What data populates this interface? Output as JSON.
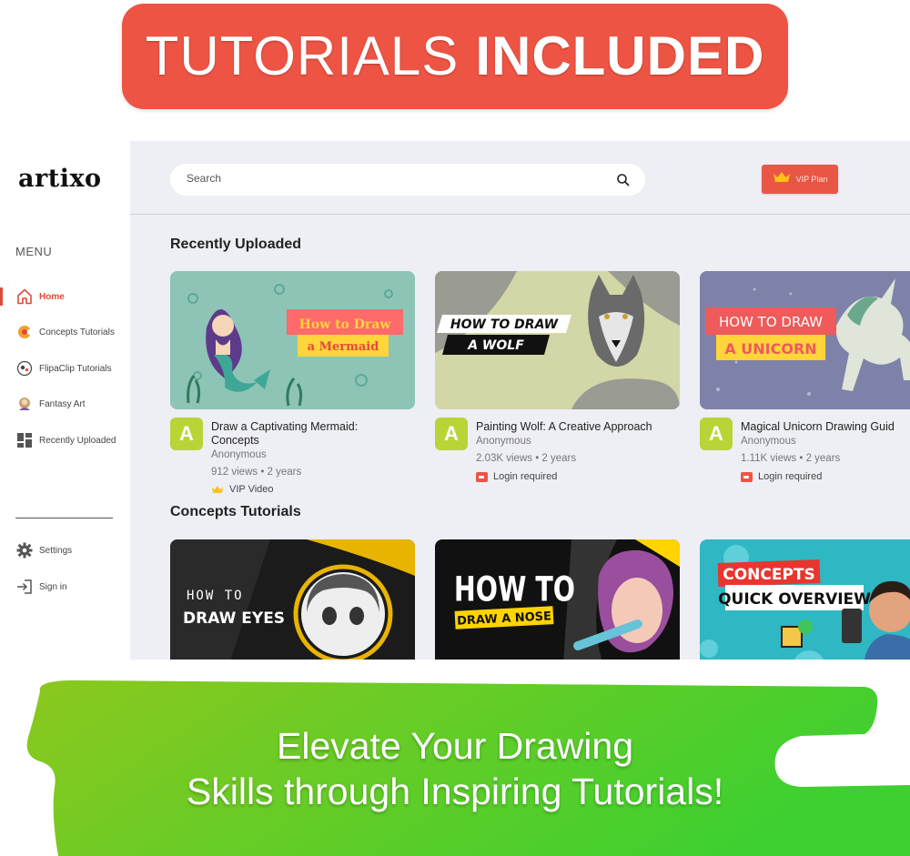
{
  "banner": {
    "top_word1": "TUTORIALS",
    "top_word2": "INCLUDED",
    "bottom_line1": "Elevate Your Drawing",
    "bottom_line2": "Skills through Inspiring Tutorials!",
    "top_color": "#ee5444",
    "bottom_gradient": [
      "#8cc81e",
      "#3ed030"
    ]
  },
  "app": {
    "logo": "artixo",
    "menu_label": "MENU",
    "nav": [
      {
        "label": "Home",
        "icon": "home-icon",
        "active": true
      },
      {
        "label": "Concepts Tutorials",
        "icon": "concepts-icon",
        "active": false
      },
      {
        "label": "FlipaClip Tutorials",
        "icon": "flipaclip-icon",
        "active": false
      },
      {
        "label": "Fantasy Art",
        "icon": "fantasy-art-icon",
        "active": false
      },
      {
        "label": "Recently Uploaded",
        "icon": "grid-icon",
        "active": false
      }
    ],
    "bottom_nav": [
      {
        "label": "Settings",
        "icon": "gear-icon"
      },
      {
        "label": "Sign in",
        "icon": "sign-in-icon"
      }
    ],
    "search": {
      "placeholder": "Search"
    },
    "vip_label": "VIP Plan",
    "accent": "#ea5644",
    "avatar_color": "#b7d537"
  },
  "sections": [
    {
      "title": "Recently Uploaded",
      "cards": [
        {
          "avatar": "A",
          "title_line1": "Draw a Captivating Mermaid:",
          "title_line2": "Concepts",
          "author": "Anonymous",
          "stats": "912 views • 2 years",
          "tag": "VIP Video",
          "tag_icon": "crown-icon",
          "thumb_text1": "How to Draw",
          "thumb_text2": "a Mermaid"
        },
        {
          "avatar": "A",
          "title_line1": "Painting Wolf: A Creative Approach",
          "title_line2": "",
          "author": "Anonymous",
          "stats": "2.03K views • 2 years",
          "tag": "Login required",
          "tag_icon": "lock-icon",
          "thumb_text1": "HOW TO DRAW",
          "thumb_text2": "A WOLF"
        },
        {
          "avatar": "A",
          "title_line1": "Magical Unicorn Drawing Guid",
          "title_line2": "",
          "author": "Anonymous",
          "stats": "1.11K views • 2 years",
          "tag": "Login required",
          "tag_icon": "lock-icon",
          "thumb_text1": "HOW TO DRAW",
          "thumb_text2": "A UNICORN"
        }
      ]
    },
    {
      "title": "Concepts Tutorials",
      "cards": [
        {
          "thumb_text1": "HOW TO",
          "thumb_text2": "DRAW EYES"
        },
        {
          "thumb_text1": "HOW TO",
          "thumb_text2": "DRAW A NOSE"
        },
        {
          "thumb_text1": "CONCEPTS",
          "thumb_text2": "QUICK OVERVIEW"
        }
      ]
    }
  ]
}
